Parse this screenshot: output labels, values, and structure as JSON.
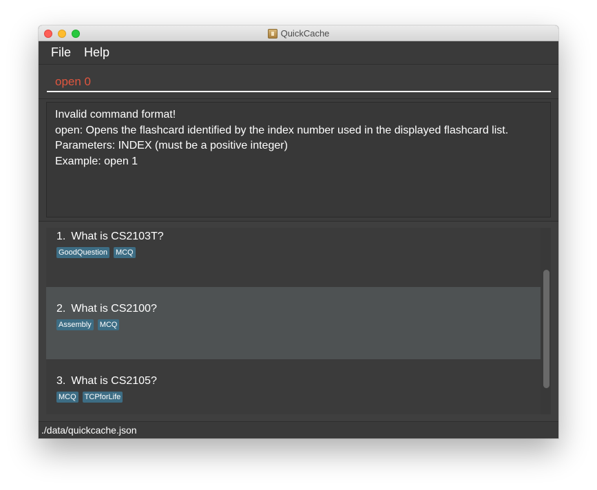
{
  "window": {
    "title": "QuickCache",
    "app_icon": "quickcache-app-icon"
  },
  "menu": {
    "items": [
      {
        "label": "File"
      },
      {
        "label": "Help"
      }
    ]
  },
  "command": {
    "value": "open 0",
    "text_color": "#e0563f"
  },
  "result": {
    "lines": [
      "Invalid command format!",
      "open: Opens the flashcard identified by the index number used in the displayed flashcard list.",
      "Parameters: INDEX (must be a positive integer)",
      "Example: open 1"
    ]
  },
  "flashcards": [
    {
      "index": "1.",
      "question": "What is CS2103T?",
      "tags": [
        "GoodQuestion",
        "MCQ"
      ],
      "selected": false
    },
    {
      "index": "2.",
      "question": "What is CS2100?",
      "tags": [
        "Assembly",
        "MCQ"
      ],
      "selected": true
    },
    {
      "index": "3.",
      "question": "What is CS2105?",
      "tags": [
        "MCQ",
        "TCPforLife"
      ],
      "selected": false
    }
  ],
  "colors": {
    "tag": "#3d6d84",
    "selected_card": "#4e5253",
    "background": "#3f3f3f"
  },
  "status": {
    "path": "./data/quickcache.json"
  }
}
